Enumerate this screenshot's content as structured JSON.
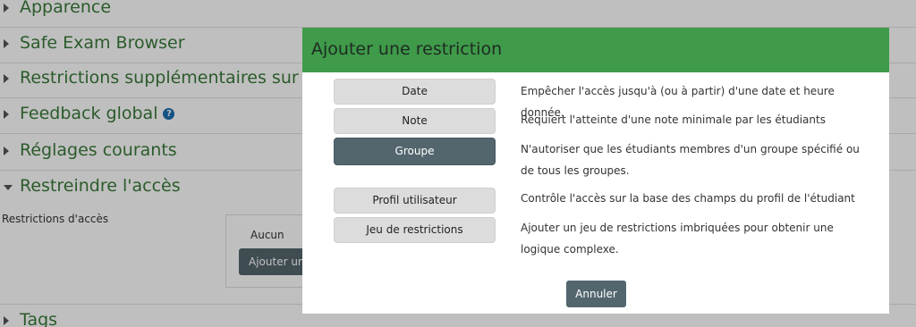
{
  "background": {
    "sections": [
      {
        "title": "Apparence",
        "expanded": false
      },
      {
        "title": "Safe Exam Browser",
        "expanded": false
      },
      {
        "title": "Restrictions supplémentaires sur les",
        "expanded": false
      },
      {
        "title": "Feedback global",
        "expanded": false,
        "has_help": true
      },
      {
        "title": "Réglages courants",
        "expanded": false
      },
      {
        "title": "Restreindre l'accès",
        "expanded": true
      },
      {
        "title": "Tags",
        "expanded": false
      }
    ],
    "restrictions_label": "Restrictions d'accès",
    "restrictions_none": "Aucun",
    "add_restriction_button": "Ajouter une restriction...",
    "help_icon_glyph": "?"
  },
  "dialog": {
    "title": "Ajouter une restriction",
    "options": [
      {
        "label": "Date",
        "description": "Empêcher l'accès jusqu'à (ou à partir) d'une date et heure donnée.",
        "selected": false
      },
      {
        "label": "Note",
        "description": "Requiert l'atteinte d'une note minimale par les étudiants",
        "selected": false
      },
      {
        "label": "Groupe",
        "description": "N'autoriser que les étudiants membres d'un groupe spécifié ou de tous les groupes.",
        "selected": true
      },
      {
        "label": "Profil utilisateur",
        "description": "Contrôle l'accès sur la base des champs du profil de l'étudiant",
        "selected": false
      },
      {
        "label": "Jeu de restrictions",
        "description": "Ajouter un jeu de restrictions imbriquées pour obtenir une logique complexe.",
        "selected": false
      }
    ],
    "cancel_button": "Annuler"
  },
  "colors": {
    "header_green": "#3f9a4a",
    "section_title_green": "#3a7a3a",
    "selected_button": "#53666e",
    "help_icon_blue": "#1a6fb0"
  }
}
